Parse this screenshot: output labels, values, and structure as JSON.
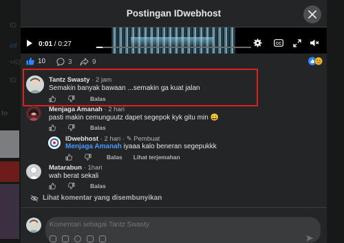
{
  "modal": {
    "title": "Postingan IDwebhost"
  },
  "video": {
    "current_time": "0:01",
    "separator": " / ",
    "duration": "0:27",
    "progress": 0.04
  },
  "reactions": {
    "like_count": "10",
    "comment_count": "3",
    "share_count": "9"
  },
  "comments": [
    {
      "author": "Tantz Swasty",
      "time": "2 jam",
      "text": "Semakin banyak bawaan ...semakin ga kuat jalan",
      "reply_label": "Balas"
    },
    {
      "author": "Menjaga Amanah",
      "time": "2 hari",
      "text": "pasti makin cemunguutz dapet segepok kyk gitu min",
      "emoji": "😀",
      "reply_label": "Balas"
    },
    {
      "author": "IDwebhost",
      "time": "2 hari",
      "badge": "Pembuat",
      "mention": "Menjaga Amanah",
      "text": "iyaaa kalo beneran segepukkk",
      "reply_label": "Balas",
      "translate_label": "Lihat terjemahan"
    },
    {
      "author": "Matarabun",
      "time": "1hari",
      "text": "wah berat sekali",
      "reply_label": "Balas"
    }
  ],
  "hidden_comments_label": "Lihat komentar yang disembunyikan",
  "composer": {
    "placeholder": "Komentari sebagai Tantz Swasty"
  },
  "background": {
    "partial_texts": [
      "ID",
      "inf",
      "+62",
      "ID",
      "to"
    ]
  },
  "colors": {
    "like_blue": "#2d88ff",
    "highlight_red": "#e0201d",
    "mention_blue": "#4599ff"
  }
}
